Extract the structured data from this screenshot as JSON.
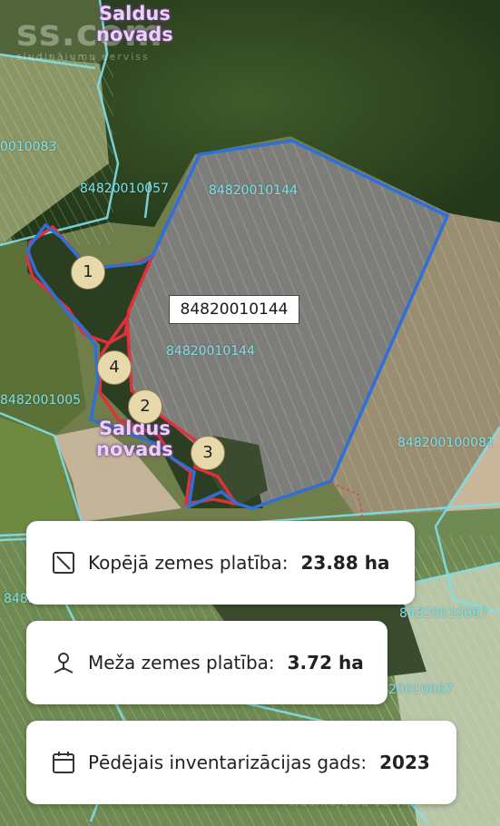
{
  "map": {
    "region_label": [
      "Saldus",
      "novads"
    ],
    "selected_parcel": "84820010144",
    "parcel_labels": [
      "0010083",
      "84820010057",
      "84820010144",
      "84820010144",
      "84820010144",
      "8482001005",
      "848200100081",
      "84820010067",
      "848200",
      "20010067"
    ],
    "markers": [
      "1",
      "2",
      "3",
      "4"
    ],
    "colors": {
      "boundary_blue": "#2f6fd8",
      "forest_red": "#e0303a",
      "cadastre_cyan": "#7fe0ea",
      "marker_fill": "#e8d9ab"
    }
  },
  "watermark": {
    "brand": "ss.com",
    "tagline": "sludinājumu serviss"
  },
  "cards": [
    {
      "icon": "area-icon",
      "label": "Kopējā zemes platība:",
      "value": "23.88 ha"
    },
    {
      "icon": "tree-icon",
      "label": "Meža zemes platība:",
      "value": "3.72 ha"
    },
    {
      "icon": "calendar-icon",
      "label": "Pēdējais inventarizācijas gads:",
      "value": "2023"
    }
  ]
}
